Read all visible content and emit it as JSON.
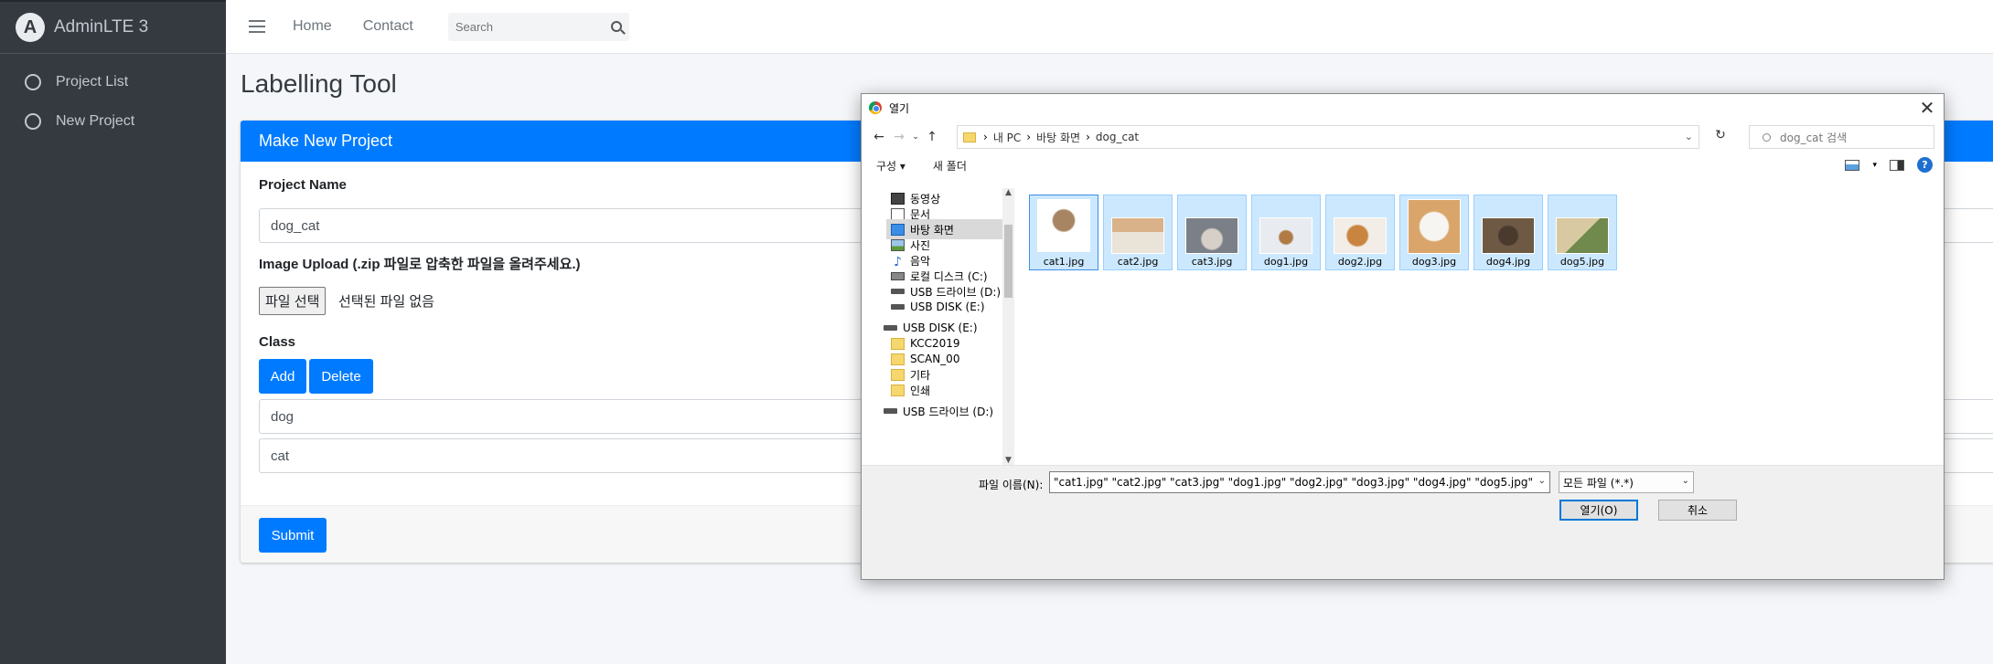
{
  "sidebar": {
    "brand": "AdminLTE 3",
    "logo_letter": "A",
    "items": [
      {
        "label": "Project List"
      },
      {
        "label": "New Project"
      }
    ]
  },
  "navbar": {
    "links": [
      "Home",
      "Contact"
    ],
    "search_placeholder": "Search"
  },
  "page": {
    "title": "Labelling Tool"
  },
  "card": {
    "header": "Make New Project",
    "project_name_label": "Project Name",
    "project_name_value": "dog_cat",
    "image_upload_label": "Image Upload (.zip 파일로 압축한 파일을 올려주세요.)",
    "file_button": "파일 선택",
    "file_status": "선택된 파일 없음",
    "class_label": "Class",
    "add_button": "Add",
    "delete_button": "Delete",
    "classes": [
      "dog",
      "cat"
    ],
    "submit_button": "Submit"
  },
  "dialog": {
    "title": "열기",
    "breadcrumb": [
      "내 PC",
      "바탕 화면",
      "dog_cat"
    ],
    "search_placeholder": "dog_cat 검색",
    "toolbar": [
      "구성 ▾",
      "새 폴더"
    ],
    "help": "?",
    "nav_items": [
      {
        "label": "동영상",
        "icon": "video-icon"
      },
      {
        "label": "문서",
        "icon": "document-icon"
      },
      {
        "label": "바탕 화면",
        "icon": "desktop-icon",
        "selected": true
      },
      {
        "label": "사진",
        "icon": "photo-icon"
      },
      {
        "label": "음악",
        "icon": "music-icon"
      },
      {
        "label": "로컬 디스크 (C:)",
        "icon": "drive-icon"
      },
      {
        "label": "USB 드라이브 (D:)",
        "icon": "usb-icon"
      },
      {
        "label": "USB DISK (E:)",
        "icon": "usb-icon"
      },
      {
        "label": "USB DISK (E:)",
        "icon": "usb-icon"
      },
      {
        "label": "KCC2019",
        "icon": "folder-icon"
      },
      {
        "label": "SCAN_00",
        "icon": "folder-icon"
      },
      {
        "label": "기타",
        "icon": "folder-icon"
      },
      {
        "label": "인쇄",
        "icon": "folder-icon"
      },
      {
        "label": "USB 드라이브 (D:)",
        "icon": "usb-icon"
      }
    ],
    "files": [
      {
        "name": "cat1.jpg"
      },
      {
        "name": "cat2.jpg"
      },
      {
        "name": "cat3.jpg"
      },
      {
        "name": "dog1.jpg"
      },
      {
        "name": "dog2.jpg"
      },
      {
        "name": "dog3.jpg"
      },
      {
        "name": "dog4.jpg"
      },
      {
        "name": "dog5.jpg"
      }
    ],
    "filename_label": "파일 이름(N):",
    "filename_value": "\"cat1.jpg\" \"cat2.jpg\" \"cat3.jpg\" \"dog1.jpg\" \"dog2.jpg\" \"dog3.jpg\" \"dog4.jpg\" \"dog5.jpg\"",
    "file_type": "모든 파일 (*.*)",
    "open_button": "열기(O)",
    "cancel_button": "취소"
  },
  "colors": {
    "sidebar_bg": "#343a40",
    "primary": "#007bff",
    "selection": "#cce8ff"
  }
}
